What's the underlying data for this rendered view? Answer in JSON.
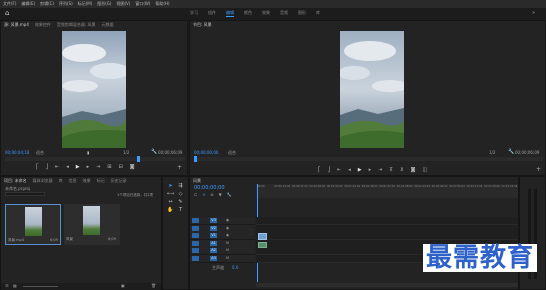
{
  "menu": [
    "文件(F)",
    "编辑(E)",
    "剪辑(C)",
    "序列(S)",
    "标记(M)",
    "图形(G)",
    "视图(V)",
    "窗口(W)",
    "帮助(H)"
  ],
  "workspaces": [
    "学习",
    "组件",
    "编辑",
    "颜色",
    "效果",
    "音频",
    "图形",
    "库"
  ],
  "active_workspace_index": 2,
  "source_monitor": {
    "tabs": [
      "源: 风景.mp4",
      "效果控件",
      "音频剪辑混合器: 风景",
      "元数据"
    ],
    "timecode_in": "00;00;04;18",
    "fit_label": "适合",
    "ratio": "1/2",
    "timecode_duration": "00;00;06;09"
  },
  "program_monitor": {
    "tabs": [
      "节目: 风景"
    ],
    "timecode_in": "00;00;00;00",
    "fit_label": "适合",
    "ratio": "1/2",
    "timecode_duration": "00;00;06;09"
  },
  "project_panel": {
    "tabs": [
      "项目: 未命名",
      "媒体浏览器",
      "库",
      "信息",
      "效果",
      "标记",
      "历史记录"
    ],
    "project_file": "未命名.prproj",
    "selection_info": "1个项目已选择，共2项",
    "items": [
      {
        "name": "风景.mp4",
        "duration": "6;09"
      },
      {
        "name": "风景",
        "duration": "6;09"
      }
    ]
  },
  "timeline": {
    "tab": "风景",
    "timecode": "00;00;00;00",
    "ruler_labels": [
      "00;00",
      "00;00;16;00",
      "00;00;32;00",
      "00;00;48;00",
      "00;01;04;02",
      "00;01;20;02",
      "00;01;36;02",
      "00;01;52;02",
      "00;02;08;04",
      "00;02;24;04",
      "00;02;40;04",
      "00;02;56;04",
      "00;03;12;06",
      "00;03;28;06",
      "00;03;44;06"
    ],
    "video_tracks": [
      "V3",
      "V2",
      "V1"
    ],
    "audio_tracks": [
      "A1",
      "A2",
      "A3"
    ],
    "master_label": "主声道",
    "master_value": "0.0"
  },
  "watermark": "最需教育",
  "icons": {
    "home": "home-icon",
    "play": "play-icon",
    "wrench": "wrench-icon"
  }
}
